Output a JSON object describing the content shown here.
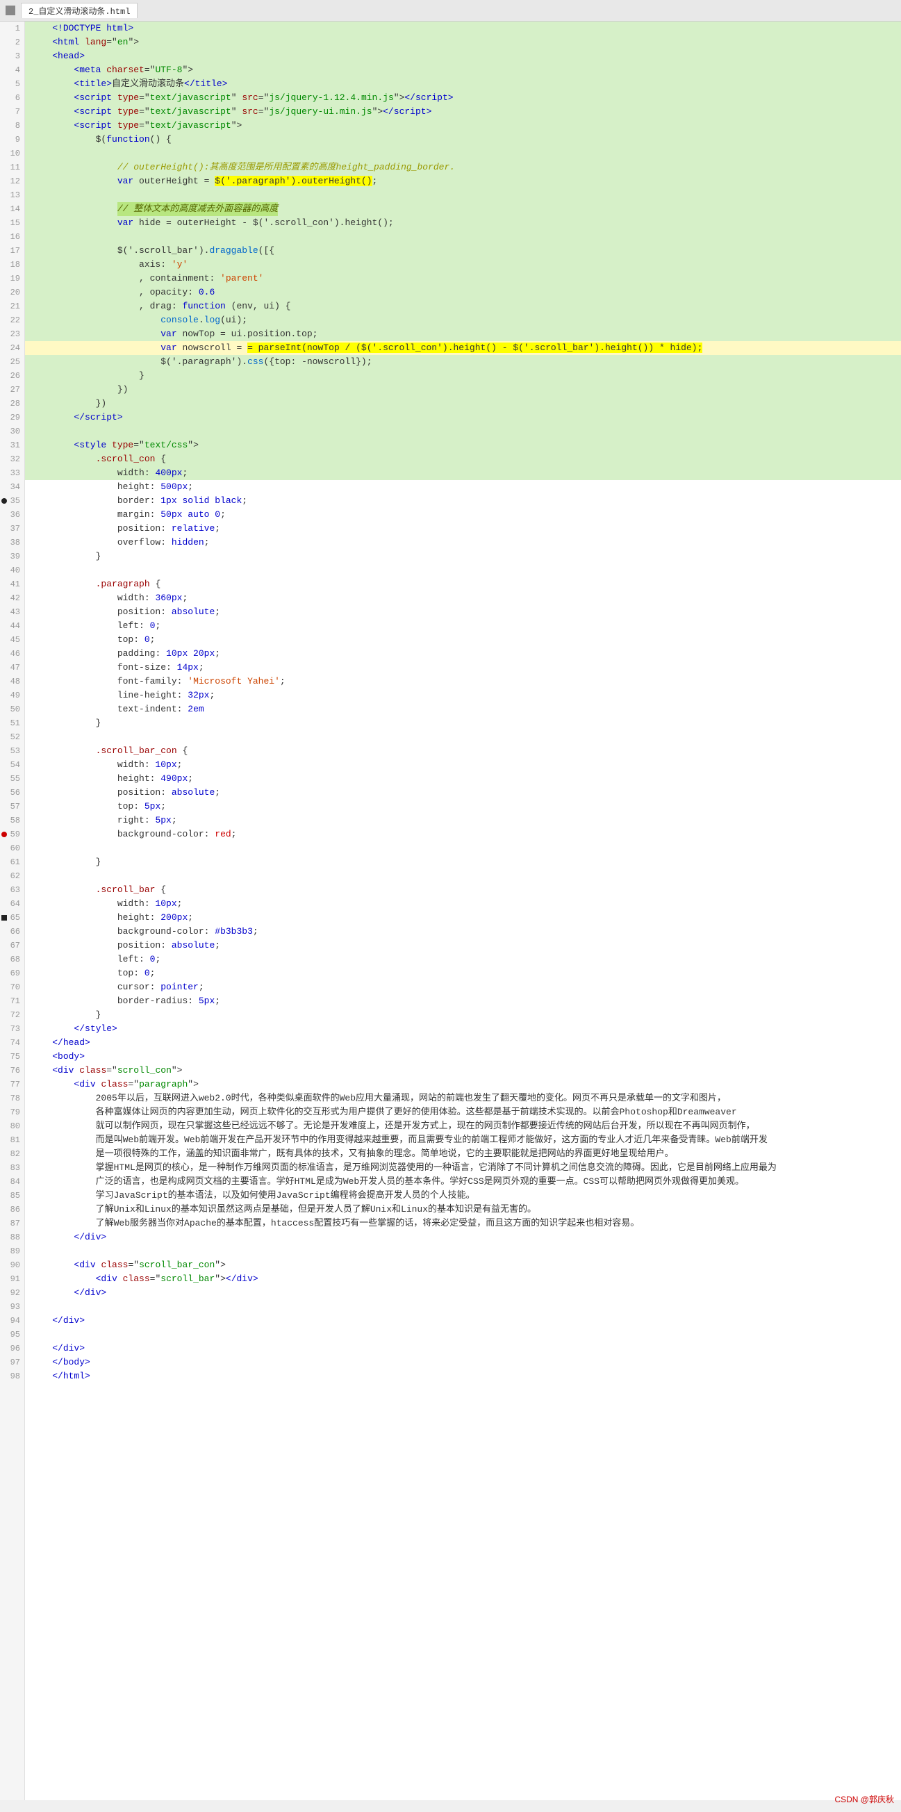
{
  "tab": {
    "title": "2_自定义滑动滚动条.html",
    "icon": "file-icon"
  },
  "lines": [
    {
      "num": 1,
      "bg": "green",
      "content": "html_doctype"
    },
    {
      "num": 2,
      "bg": "green",
      "content": "html_open"
    },
    {
      "num": 3,
      "bg": "green",
      "content": "head_open"
    },
    {
      "num": 4,
      "bg": "green",
      "content": "meta"
    },
    {
      "num": 5,
      "bg": "green",
      "content": "title"
    },
    {
      "num": 6,
      "bg": "green",
      "content": "script1"
    },
    {
      "num": 7,
      "bg": "green",
      "content": "script2"
    },
    {
      "num": 8,
      "bg": "green",
      "content": "script3"
    },
    {
      "num": 9,
      "bg": "green",
      "content": "fn_start"
    },
    {
      "num": 10,
      "bg": "green",
      "content": "blank"
    },
    {
      "num": 11,
      "bg": "green",
      "content": "comment1"
    },
    {
      "num": 12,
      "bg": "green",
      "content": "var_outer"
    },
    {
      "num": 13,
      "bg": "green",
      "content": "blank"
    },
    {
      "num": 14,
      "bg": "green",
      "content": "comment2"
    },
    {
      "num": 15,
      "bg": "green",
      "content": "var_hide"
    },
    {
      "num": 16,
      "bg": "green",
      "content": "blank"
    },
    {
      "num": 17,
      "bg": "green",
      "content": "draggable"
    },
    {
      "num": 18,
      "bg": "green",
      "content": "axis"
    },
    {
      "num": 19,
      "bg": "green",
      "content": "containment"
    },
    {
      "num": 20,
      "bg": "green",
      "content": "opacity"
    },
    {
      "num": 21,
      "bg": "green",
      "content": "drag_fn"
    },
    {
      "num": 22,
      "bg": "green",
      "content": "console"
    },
    {
      "num": 23,
      "bg": "green",
      "content": "var_nowtop"
    },
    {
      "num": 24,
      "bg": "yellow",
      "content": "var_nowscroll"
    },
    {
      "num": 25,
      "bg": "green",
      "content": "css_paragraph"
    },
    {
      "num": 26,
      "bg": "green",
      "content": "close_brace1"
    },
    {
      "num": 27,
      "bg": "green",
      "content": "close_brace2"
    },
    {
      "num": 28,
      "bg": "green",
      "content": "close_paren"
    },
    {
      "num": 29,
      "bg": "green",
      "content": "script_close"
    },
    {
      "num": 30,
      "bg": "green",
      "content": "blank"
    },
    {
      "num": 31,
      "bg": "green",
      "content": "style_open"
    },
    {
      "num": 32,
      "bg": "green",
      "content": "scroll_con_selector"
    },
    {
      "num": 33,
      "bg": "green",
      "content": "width_400"
    },
    {
      "num": 34,
      "bg": "white",
      "content": "height_500"
    },
    {
      "num": 35,
      "bg": "white",
      "content": "border_solid",
      "marker": "black"
    },
    {
      "num": 36,
      "bg": "white",
      "content": "margin_50"
    },
    {
      "num": 37,
      "bg": "white",
      "content": "position_relative"
    },
    {
      "num": 38,
      "bg": "white",
      "content": "overflow_hidden"
    },
    {
      "num": 39,
      "bg": "white",
      "content": "close_brace"
    },
    {
      "num": 40,
      "bg": "white",
      "content": "blank"
    },
    {
      "num": 41,
      "bg": "white",
      "content": "paragraph_selector"
    },
    {
      "num": 42,
      "bg": "white",
      "content": "width_360"
    },
    {
      "num": 43,
      "bg": "white",
      "content": "position_absolute"
    },
    {
      "num": 44,
      "bg": "white",
      "content": "left_0"
    },
    {
      "num": 45,
      "bg": "white",
      "content": "top_0"
    },
    {
      "num": 46,
      "bg": "white",
      "content": "padding_10"
    },
    {
      "num": 47,
      "bg": "white",
      "content": "font_size_14"
    },
    {
      "num": 48,
      "bg": "white",
      "content": "font_family"
    },
    {
      "num": 49,
      "bg": "white",
      "content": "line_height_32"
    },
    {
      "num": 50,
      "bg": "white",
      "content": "text_indent"
    },
    {
      "num": 51,
      "bg": "white",
      "content": "close_brace"
    },
    {
      "num": 52,
      "bg": "white",
      "content": "blank"
    },
    {
      "num": 53,
      "bg": "white",
      "content": "scroll_bar_con_selector"
    },
    {
      "num": 54,
      "bg": "white",
      "content": "width_10"
    },
    {
      "num": 55,
      "bg": "white",
      "content": "height_490"
    },
    {
      "num": 56,
      "bg": "white",
      "content": "position_absolute2"
    },
    {
      "num": 57,
      "bg": "white",
      "content": "top_5"
    },
    {
      "num": 58,
      "bg": "white",
      "content": "right_5",
      "marker": "red"
    },
    {
      "num": 59,
      "bg": "white",
      "content": "bg_red",
      "marker": "red"
    },
    {
      "num": 60,
      "bg": "white",
      "content": "blank"
    },
    {
      "num": 61,
      "bg": "white",
      "content": "close_brace"
    },
    {
      "num": 62,
      "bg": "white",
      "content": "blank"
    },
    {
      "num": 63,
      "bg": "white",
      "content": "scroll_bar_selector"
    },
    {
      "num": 64,
      "bg": "white",
      "content": "width_10b"
    },
    {
      "num": 65,
      "bg": "white",
      "content": "height_200",
      "marker": "square"
    },
    {
      "num": 66,
      "bg": "white",
      "content": "bg_b3b3b3"
    },
    {
      "num": 67,
      "bg": "white",
      "content": "blank"
    },
    {
      "num": 68,
      "bg": "white",
      "content": "position_absolute3"
    },
    {
      "num": 69,
      "bg": "white",
      "content": "left_0b"
    },
    {
      "num": 70,
      "bg": "white",
      "content": "top_0b"
    },
    {
      "num": 71,
      "bg": "white",
      "content": "cursor_pointer"
    },
    {
      "num": 72,
      "bg": "white",
      "content": "border_radius"
    },
    {
      "num": 73,
      "bg": "white",
      "content": "close_brace2"
    },
    {
      "num": 74,
      "bg": "white",
      "content": "style_close"
    },
    {
      "num": 75,
      "bg": "white",
      "content": "head_close"
    },
    {
      "num": 76,
      "bg": "white",
      "content": "body_open"
    },
    {
      "num": 77,
      "bg": "white",
      "content": "div_scroll_con"
    },
    {
      "num": 78,
      "bg": "white",
      "content": "div_paragraph"
    },
    {
      "num": 79,
      "bg": "white",
      "content": "text1"
    },
    {
      "num": 80,
      "bg": "white",
      "content": "text2"
    },
    {
      "num": 81,
      "bg": "white",
      "content": "text3"
    },
    {
      "num": 82,
      "bg": "white",
      "content": "text4"
    },
    {
      "num": 83,
      "bg": "white",
      "content": "text5"
    },
    {
      "num": 84,
      "bg": "white",
      "content": "text6"
    },
    {
      "num": 85,
      "bg": "white",
      "content": "text7"
    },
    {
      "num": 86,
      "bg": "white",
      "content": "text8"
    },
    {
      "num": 87,
      "bg": "white",
      "content": "text9"
    },
    {
      "num": 88,
      "bg": "white",
      "content": "div_close1"
    },
    {
      "num": 89,
      "bg": "white",
      "content": "blank"
    },
    {
      "num": 90,
      "bg": "white",
      "content": "div_scroll_bar_con"
    },
    {
      "num": 91,
      "bg": "white",
      "content": "div_scroll_bar"
    },
    {
      "num": 92,
      "bg": "white",
      "content": "div_close2"
    },
    {
      "num": 93,
      "bg": "white",
      "content": "blank"
    },
    {
      "num": 94,
      "bg": "white",
      "content": "div_close3"
    },
    {
      "num": 95,
      "bg": "white",
      "content": "blank"
    },
    {
      "num": 96,
      "bg": "white",
      "content": "div_close4"
    },
    {
      "num": 97,
      "bg": "white",
      "content": "body_close"
    },
    {
      "num": 98,
      "bg": "white",
      "content": "html_close"
    }
  ],
  "watermark": "CSDN @郭庆秋"
}
